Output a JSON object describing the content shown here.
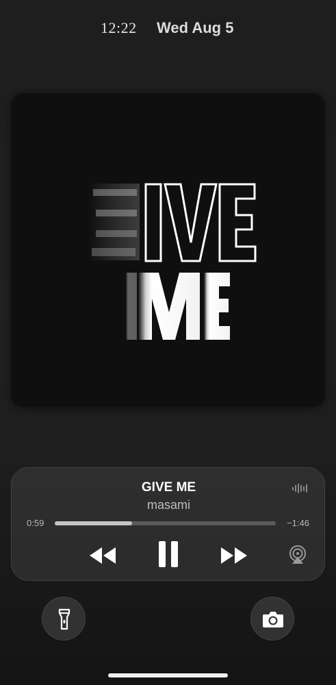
{
  "status_bar": {
    "time": "12:22",
    "date": "Wed Aug 5"
  },
  "artwork": {
    "line1": "GIVE",
    "line2": "ME"
  },
  "now_playing": {
    "title": "GIVE ME",
    "artist": "masami",
    "elapsed": "0:59",
    "remaining": "−1:46",
    "progress": 0.35
  },
  "controls": {
    "rewind_icon": "rewind-icon",
    "pause_icon": "pause-icon",
    "forward_icon": "fast-forward-icon",
    "airplay_icon": "airplay-audio-icon",
    "waveform_icon": "audio-waveform-icon"
  },
  "quick_actions": {
    "left": "flashlight-icon",
    "right": "camera-icon"
  }
}
